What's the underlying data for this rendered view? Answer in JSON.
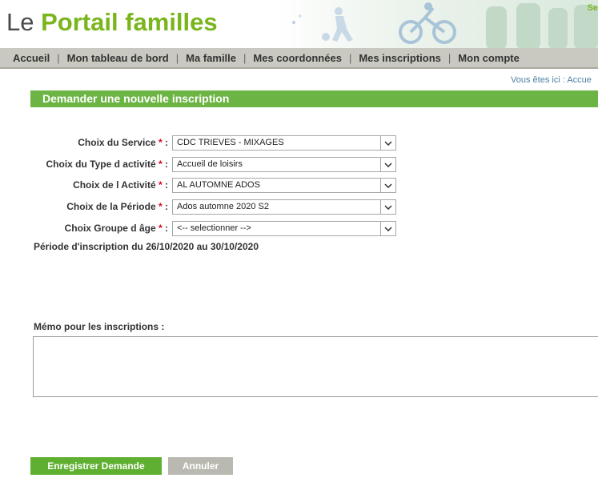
{
  "header": {
    "brand_prefix": "Le ",
    "brand_name": "Portail familles",
    "banner_corner_text": "Se"
  },
  "nav": {
    "items": [
      "Accueil",
      "Mon tableau de bord",
      "Ma famille",
      "Mes coordonnées",
      "Mes inscriptions",
      "Mon compte"
    ],
    "separator": "|"
  },
  "breadcrumb": "Vous êtes ici : Accue",
  "form": {
    "title": "Demander une nouvelle inscription",
    "required_mark": "*",
    "fields": [
      {
        "label": "Choix du Service",
        "value": "CDC TRIEVES - MIXAGES"
      },
      {
        "label": "Choix du Type d activité",
        "value": "Accueil de loisirs"
      },
      {
        "label": "Choix de l Activité",
        "value": "AL AUTOMNE ADOS"
      },
      {
        "label": "Choix de la Période",
        "value": "Ados automne 2020 S2"
      },
      {
        "label": "Choix Groupe d âge",
        "value": "<-- selectionner -->"
      }
    ],
    "period_text": "Période d'inscription du 26/10/2020 au 30/10/2020",
    "memo_label": "Mémo pour les inscriptions :",
    "memo_value": "",
    "save_label": "Enregistrer Demande",
    "cancel_label": "Annuler"
  },
  "colors": {
    "brand_green": "#7ab51d",
    "title_bar": "#6cb443",
    "save_button": "#5fb030",
    "cancel_button": "#b9b9b1",
    "nav_bg": "#c9c9c1",
    "required": "#e0001b"
  }
}
